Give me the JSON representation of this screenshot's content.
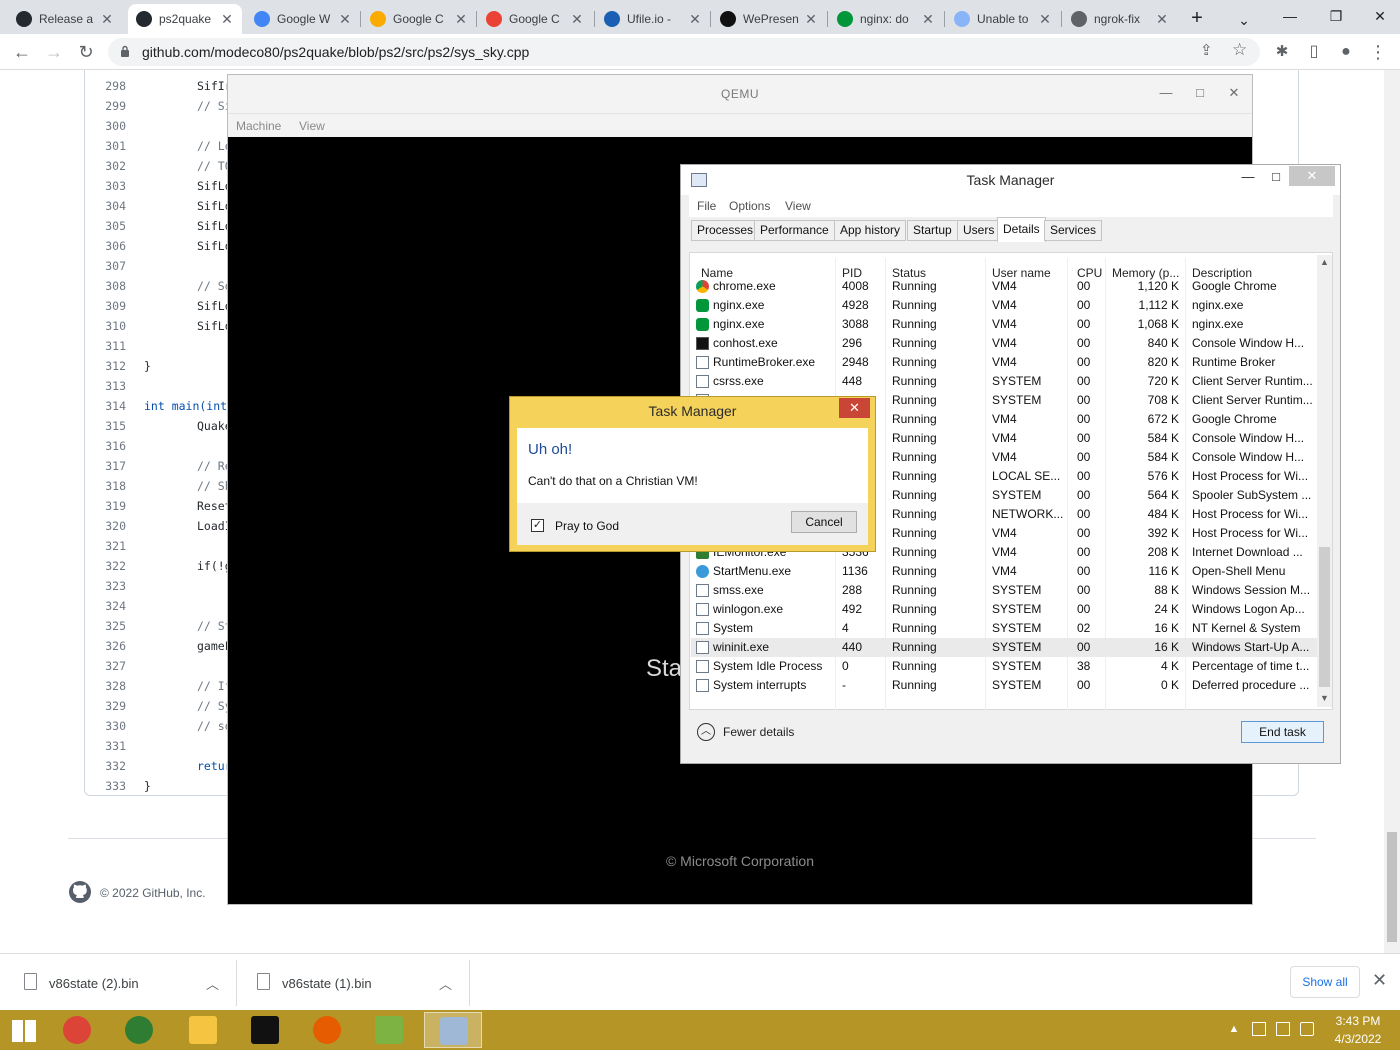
{
  "browser": {
    "tabs": [
      {
        "label": "Release a",
        "icon": "github-icon",
        "color": "#24292f"
      },
      {
        "label": "ps2quake",
        "icon": "github-icon",
        "color": "#24292f",
        "active": true
      },
      {
        "label": "Google W",
        "icon": "google-icon",
        "color": "#4285f4"
      },
      {
        "label": "Google C",
        "icon": "colab-icon",
        "color": "#f9ab00"
      },
      {
        "label": "Google C",
        "icon": "cloud-icon",
        "color": "#ea4335"
      },
      {
        "label": "Ufile.io -",
        "icon": "ufile-icon",
        "color": "#1a5fb4"
      },
      {
        "label": "WePresen",
        "icon": "wetransfer-icon",
        "color": "#111111"
      },
      {
        "label": "nginx: do",
        "icon": "nginx-icon",
        "color": "#009639"
      },
      {
        "label": "Unable to",
        "icon": "page-icon",
        "color": "#8ab4f8"
      },
      {
        "label": "ngrok-fix",
        "icon": "globe-icon",
        "color": "#5f6368"
      }
    ],
    "new_tab": "+",
    "tab_search": "⌄",
    "window_controls": {
      "minimize": "—",
      "maximize": "❐",
      "close": "✕"
    },
    "nav": {
      "back": "←",
      "forward": "→",
      "reload": "↻"
    },
    "url": "github.com/modeco80/ps2quake/blob/ps2/src/ps2/sys_sky.cpp",
    "toolbar_icons": {
      "share": "⇪",
      "bookmark": "☆",
      "extensions": "✱",
      "sidepanel": "▯",
      "profile": "●",
      "menu": "⋮"
    }
  },
  "code": {
    "lines": [
      {
        "n": "298",
        "t": "SifIr",
        "k": "code"
      },
      {
        "n": "299",
        "t": "// Si",
        "k": "comment"
      },
      {
        "n": "300",
        "t": "",
        "k": "code"
      },
      {
        "n": "301",
        "t": "// Lo",
        "k": "comment"
      },
      {
        "n": "302",
        "t": "// TO",
        "k": "comment"
      },
      {
        "n": "303",
        "t": "SifLo",
        "k": "code"
      },
      {
        "n": "304",
        "t": "SifLo",
        "k": "code"
      },
      {
        "n": "305",
        "t": "SifLo",
        "k": "code"
      },
      {
        "n": "306",
        "t": "SifLo",
        "k": "code"
      },
      {
        "n": "307",
        "t": "",
        "k": "code"
      },
      {
        "n": "308",
        "t": "// So",
        "k": "comment"
      },
      {
        "n": "309",
        "t": "SifLo",
        "k": "code"
      },
      {
        "n": "310",
        "t": "SifLo",
        "k": "code"
      },
      {
        "n": "311",
        "t": "",
        "k": "code"
      },
      {
        "n": "312",
        "t": "}",
        "k": "outer"
      },
      {
        "n": "313",
        "t": "",
        "k": "code"
      },
      {
        "n": "314",
        "t": "int main(int",
        "k": "keyword"
      },
      {
        "n": "315",
        "t": "Quake",
        "k": "code"
      },
      {
        "n": "316",
        "t": "",
        "k": "code"
      },
      {
        "n": "317",
        "t": "// Re",
        "k": "comment"
      },
      {
        "n": "318",
        "t": "// Sh",
        "k": "comment"
      },
      {
        "n": "319",
        "t": "Reset",
        "k": "code"
      },
      {
        "n": "320",
        "t": "LoadI",
        "k": "code"
      },
      {
        "n": "321",
        "t": "",
        "k": "code"
      },
      {
        "n": "322",
        "t": "if(!g",
        "k": "code"
      },
      {
        "n": "323",
        "t": "",
        "k": "code"
      },
      {
        "n": "324",
        "t": "",
        "k": "code"
      },
      {
        "n": "325",
        "t": "// St",
        "k": "comment"
      },
      {
        "n": "326",
        "t": "gameL",
        "k": "code"
      },
      {
        "n": "327",
        "t": "",
        "k": "code"
      },
      {
        "n": "328",
        "t": "// If",
        "k": "comment"
      },
      {
        "n": "329",
        "t": "// Sy",
        "k": "comment"
      },
      {
        "n": "330",
        "t": "// so",
        "k": "comment"
      },
      {
        "n": "331",
        "t": "",
        "k": "code"
      },
      {
        "n": "332",
        "t": "retur",
        "k": "keyword"
      },
      {
        "n": "333",
        "t": "}",
        "k": "outer"
      }
    ],
    "footer": "© 2022 GitHub, Inc."
  },
  "qemu": {
    "title": "QEMU",
    "controls": {
      "minimize": "—",
      "maximize": "□",
      "close": "✕"
    },
    "menu": [
      "Machine",
      "View"
    ],
    "screen_text": "Sta",
    "copyright": "© Microsoft Corporation"
  },
  "taskmgr": {
    "title": "Task Manager",
    "controls": {
      "minimize": "—",
      "maximize": "□",
      "close": "✕"
    },
    "menu": [
      "File",
      "Options",
      "View"
    ],
    "tabs": [
      "Processes",
      "Performance",
      "App history",
      "Startup",
      "Users",
      "Details",
      "Services"
    ],
    "active_tab": "Details",
    "columns": [
      "Name",
      "PID",
      "Status",
      "User name",
      "CPU",
      "Memory (p...",
      "Description"
    ],
    "rows": [
      {
        "name": "chrome.exe",
        "pid": "4008",
        "status": "Running",
        "user": "VM4",
        "cpu": "00",
        "mem": "1,120 K",
        "desc": "Google Chrome",
        "icon": "chrome"
      },
      {
        "name": "nginx.exe",
        "pid": "4928",
        "status": "Running",
        "user": "VM4",
        "cpu": "00",
        "mem": "1,112 K",
        "desc": "nginx.exe",
        "icon": "nginx"
      },
      {
        "name": "nginx.exe",
        "pid": "3088",
        "status": "Running",
        "user": "VM4",
        "cpu": "00",
        "mem": "1,068 K",
        "desc": "nginx.exe",
        "icon": "nginx"
      },
      {
        "name": "conhost.exe",
        "pid": "296",
        "status": "Running",
        "user": "VM4",
        "cpu": "00",
        "mem": "840 K",
        "desc": "Console Window H...",
        "icon": "console"
      },
      {
        "name": "RuntimeBroker.exe",
        "pid": "2948",
        "status": "Running",
        "user": "VM4",
        "cpu": "00",
        "mem": "820 K",
        "desc": "Runtime Broker",
        "icon": "app"
      },
      {
        "name": "csrss.exe",
        "pid": "448",
        "status": "Running",
        "user": "SYSTEM",
        "cpu": "00",
        "mem": "720 K",
        "desc": "Client Server Runtim...",
        "icon": "app"
      },
      {
        "name": "",
        "pid": "",
        "status": "Running",
        "user": "SYSTEM",
        "cpu": "00",
        "mem": "708 K",
        "desc": "Client Server Runtim...",
        "icon": "app"
      },
      {
        "name": "",
        "pid": "",
        "status": "Running",
        "user": "VM4",
        "cpu": "00",
        "mem": "672 K",
        "desc": "Google Chrome",
        "icon": "chrome"
      },
      {
        "name": "",
        "pid": "",
        "status": "Running",
        "user": "VM4",
        "cpu": "00",
        "mem": "584 K",
        "desc": "Console Window H...",
        "icon": "console"
      },
      {
        "name": "",
        "pid": "",
        "status": "Running",
        "user": "VM4",
        "cpu": "00",
        "mem": "584 K",
        "desc": "Console Window H...",
        "icon": "console"
      },
      {
        "name": "",
        "pid": "",
        "status": "Running",
        "user": "LOCAL SE...",
        "cpu": "00",
        "mem": "576 K",
        "desc": "Host Process for Wi...",
        "icon": "app"
      },
      {
        "name": "",
        "pid": "",
        "status": "Running",
        "user": "SYSTEM",
        "cpu": "00",
        "mem": "564 K",
        "desc": "Spooler SubSystem ...",
        "icon": "app"
      },
      {
        "name": "",
        "pid": "",
        "status": "Running",
        "user": "NETWORK...",
        "cpu": "00",
        "mem": "484 K",
        "desc": "Host Process for Wi...",
        "icon": "app"
      },
      {
        "name": "",
        "pid": "",
        "status": "Running",
        "user": "VM4",
        "cpu": "00",
        "mem": "392 K",
        "desc": "Host Process for Wi...",
        "icon": "app"
      },
      {
        "name": "IEMonitor.exe",
        "pid": "3536",
        "status": "Running",
        "user": "VM4",
        "cpu": "00",
        "mem": "208 K",
        "desc": "Internet Download ...",
        "icon": "idm"
      },
      {
        "name": "StartMenu.exe",
        "pid": "1136",
        "status": "Running",
        "user": "VM4",
        "cpu": "00",
        "mem": "116 K",
        "desc": "Open-Shell Menu",
        "icon": "shell"
      },
      {
        "name": "smss.exe",
        "pid": "288",
        "status": "Running",
        "user": "SYSTEM",
        "cpu": "00",
        "mem": "88 K",
        "desc": "Windows Session M...",
        "icon": "app"
      },
      {
        "name": "winlogon.exe",
        "pid": "492",
        "status": "Running",
        "user": "SYSTEM",
        "cpu": "00",
        "mem": "24 K",
        "desc": "Windows Logon Ap...",
        "icon": "app"
      },
      {
        "name": "System",
        "pid": "4",
        "status": "Running",
        "user": "SYSTEM",
        "cpu": "02",
        "mem": "16 K",
        "desc": "NT Kernel & System",
        "icon": "app"
      },
      {
        "name": "wininit.exe",
        "pid": "440",
        "status": "Running",
        "user": "SYSTEM",
        "cpu": "00",
        "mem": "16 K",
        "desc": "Windows Start-Up A...",
        "icon": "app",
        "selected": true
      },
      {
        "name": "System Idle Process",
        "pid": "0",
        "status": "Running",
        "user": "SYSTEM",
        "cpu": "38",
        "mem": "4 K",
        "desc": "Percentage of time t...",
        "icon": "app"
      },
      {
        "name": "System interrupts",
        "pid": "-",
        "status": "Running",
        "user": "SYSTEM",
        "cpu": "00",
        "mem": "0 K",
        "desc": "Deferred procedure ...",
        "icon": "app"
      }
    ],
    "fewer_details": "Fewer details",
    "end_task": "End task",
    "scroll_up": "▲",
    "scroll_down": "▼",
    "fewer_icon": "︿"
  },
  "dialog": {
    "title": "Task Manager",
    "close": "✕",
    "heading": "Uh oh!",
    "message": "Can't do that on a Christian VM!",
    "checkbox_label": "Pray to God",
    "checkbox_checked": "✓",
    "cancel": "Cancel"
  },
  "downloads": {
    "items": [
      {
        "name": "v86state (2).bin",
        "chevron": "︿"
      },
      {
        "name": "v86state (1).bin",
        "chevron": "︿"
      }
    ],
    "show_all": "Show all",
    "close": "✕"
  },
  "taskbar": {
    "apps": [
      {
        "name": "start-button",
        "color": "#ffffff"
      },
      {
        "name": "chrome",
        "color": "#db4437"
      },
      {
        "name": "network-globe",
        "color": "#2e7d32"
      },
      {
        "name": "file-explorer",
        "color": "#f5c542"
      },
      {
        "name": "command-prompt",
        "color": "#111111"
      },
      {
        "name": "qemu",
        "color": "#e65c00"
      },
      {
        "name": "notepad-plus-plus",
        "color": "#7cb342"
      },
      {
        "name": "task-manager",
        "color": "#9fb8d6"
      }
    ],
    "tray_arrow": "▲",
    "time": "3:43 PM",
    "date": "4/3/2022"
  }
}
